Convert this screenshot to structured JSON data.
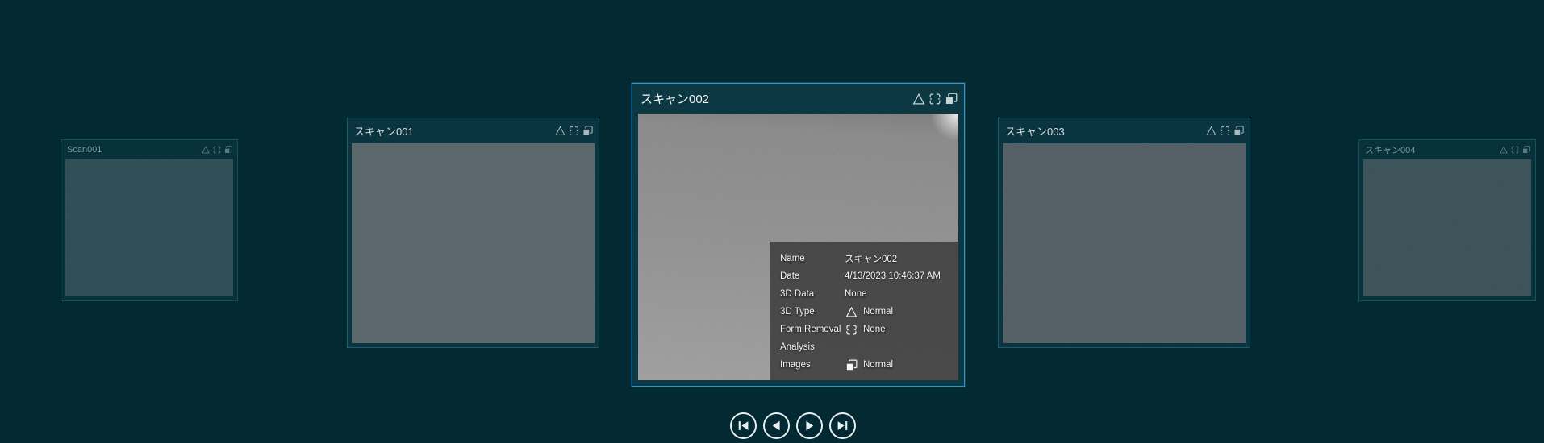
{
  "carousel": {
    "cards": [
      {
        "title": "Scan001",
        "state": "distant"
      },
      {
        "title": "スキャン001",
        "state": "adjacent"
      },
      {
        "title": "スキャン002",
        "state": "selected"
      },
      {
        "title": "スキャン003",
        "state": "adjacent"
      },
      {
        "title": "スキャン004",
        "state": "distant"
      }
    ],
    "card_status_icons": [
      "3d-type-triangle",
      "form-removal-frame",
      "images-overlapping-squares"
    ]
  },
  "tooltip": {
    "rows": [
      {
        "label": "Name",
        "value": "スキャン002",
        "icon": ""
      },
      {
        "label": "Date",
        "value": "4/13/2023 10:46:37 AM",
        "icon": ""
      },
      {
        "label": "3D Data",
        "value": "None",
        "icon": ""
      },
      {
        "label": "3D Type",
        "value": "Normal",
        "icon": "triangle-icon"
      },
      {
        "label": "Form Removal",
        "value": "None",
        "icon": "form-removal-icon"
      },
      {
        "label": "Analysis",
        "value": "",
        "icon": ""
      },
      {
        "label": "Images",
        "value": "Normal",
        "icon": "images-icon"
      }
    ]
  },
  "nav": {
    "buttons": [
      "skip-to-first",
      "previous",
      "next",
      "skip-to-last"
    ]
  },
  "colors": {
    "background": "#032A33",
    "selected_border": "#2F95CE",
    "card_border": "#1D5B69",
    "tooltip_background": "rgba(64,64,64,0.9)",
    "nav_outline": "#E9EEF0",
    "selected_thumb_gray": "#8A8A8A"
  }
}
